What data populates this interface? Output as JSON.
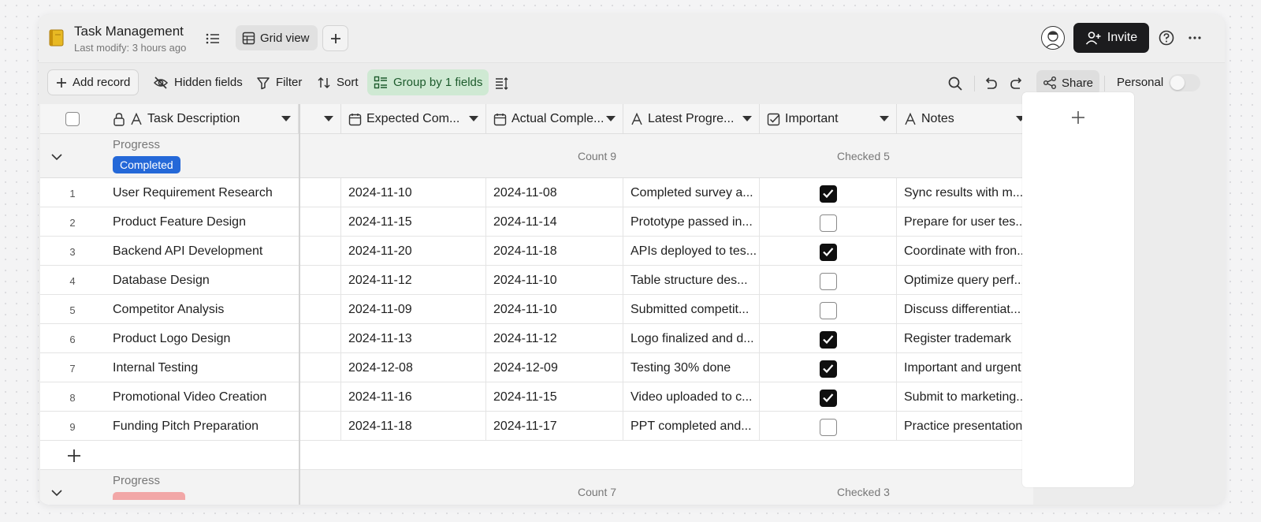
{
  "header": {
    "title": "Task Management",
    "subtitle": "Last modify: 3 hours ago",
    "view_label": "Grid view",
    "invite_label": "Invite"
  },
  "toolbar": {
    "add_record": "Add record",
    "hidden_fields": "Hidden fields",
    "filter": "Filter",
    "sort": "Sort",
    "group_by": "Group by 1 fields",
    "share": "Share",
    "personal": "Personal"
  },
  "columns": {
    "task_description": "Task Description",
    "expected": "Expected Com...",
    "actual": "Actual Comple...",
    "latest": "Latest Progre...",
    "important": "Important",
    "notes": "Notes"
  },
  "groups": [
    {
      "label": "Progress",
      "value": "Completed",
      "count": "Count 9",
      "checked": "Checked 5",
      "rows": [
        {
          "num": "1",
          "task": "User Requirement Research",
          "expected": "2024-11-10",
          "actual": "2024-11-08",
          "latest": "Completed survey a...",
          "important": true,
          "notes": "Sync results with m..."
        },
        {
          "num": "2",
          "task": "Product Feature Design",
          "expected": "2024-11-15",
          "actual": "2024-11-14",
          "latest": "Prototype passed in...",
          "important": false,
          "notes": "Prepare for user tes..."
        },
        {
          "num": "3",
          "task": "Backend API Development",
          "expected": "2024-11-20",
          "actual": "2024-11-18",
          "latest": "APIs deployed to tes...",
          "important": true,
          "notes": "Coordinate with fron..."
        },
        {
          "num": "4",
          "task": "Database Design",
          "expected": "2024-11-12",
          "actual": "2024-11-10",
          "latest": "Table structure des...",
          "important": false,
          "notes": "Optimize query perf..."
        },
        {
          "num": "5",
          "task": "Competitor Analysis",
          "expected": "2024-11-09",
          "actual": "2024-11-10",
          "latest": "Submitted competit...",
          "important": false,
          "notes": "Discuss differentiat..."
        },
        {
          "num": "6",
          "task": "Product Logo Design",
          "expected": "2024-11-13",
          "actual": "2024-11-12",
          "latest": "Logo finalized and d...",
          "important": true,
          "notes": "Register trademark"
        },
        {
          "num": "7",
          "task": "Internal Testing",
          "expected": "2024-12-08",
          "actual": "2024-12-09",
          "latest": "Testing 30% done",
          "important": true,
          "notes": "Important and urgent"
        },
        {
          "num": "8",
          "task": "Promotional Video Creation",
          "expected": "2024-11-16",
          "actual": "2024-11-15",
          "latest": "Video uploaded to c...",
          "important": true,
          "notes": "Submit to marketing..."
        },
        {
          "num": "9",
          "task": "Funding Pitch Preparation",
          "expected": "2024-11-18",
          "actual": "2024-11-17",
          "latest": "PPT completed and...",
          "important": false,
          "notes": "Practice presentation"
        }
      ]
    },
    {
      "label": "Progress",
      "count": "Count 7",
      "checked": "Checked 3"
    }
  ],
  "icons": {
    "logo": "notebook-icon",
    "list": "list-icon",
    "grid": "grid-icon",
    "add_view": "plus-icon",
    "search": "search-icon",
    "undo": "undo-icon",
    "redo": "redo-icon",
    "share": "share-icon",
    "help": "help-icon",
    "more": "more-icon"
  },
  "colors": {
    "accent_blue": "#2468d8",
    "group_active": "#cfe9d3",
    "invite_bg": "#1c1c1e",
    "checkbox_on": "#0f0f0f"
  }
}
